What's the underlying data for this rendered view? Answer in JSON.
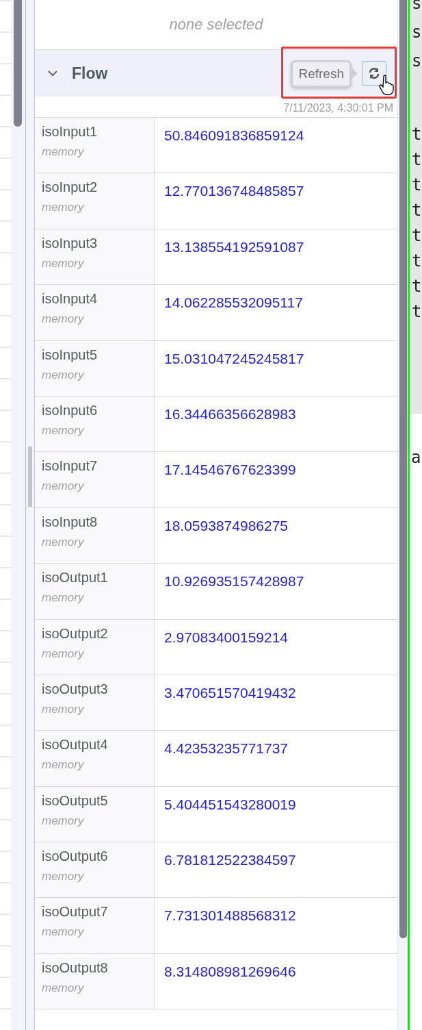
{
  "selection": {
    "text": "none selected"
  },
  "section": {
    "title": "Flow",
    "expanded": true,
    "tooltip": "Refresh",
    "timestamp": "7/11/2023, 4:30:01 PM"
  },
  "rows": [
    {
      "name": "isoInput1",
      "store": "memory",
      "value": "50.846091836859124"
    },
    {
      "name": "isoInput2",
      "store": "memory",
      "value": "12.770136748485857"
    },
    {
      "name": "isoInput3",
      "store": "memory",
      "value": "13.138554192591087"
    },
    {
      "name": "isoInput4",
      "store": "memory",
      "value": "14.062285532095117"
    },
    {
      "name": "isoInput5",
      "store": "memory",
      "value": "15.031047245245817"
    },
    {
      "name": "isoInput6",
      "store": "memory",
      "value": "16.34466356628983"
    },
    {
      "name": "isoInput7",
      "store": "memory",
      "value": "17.14546767623399"
    },
    {
      "name": "isoInput8",
      "store": "memory",
      "value": "18.0593874986275"
    },
    {
      "name": "isoOutput1",
      "store": "memory",
      "value": "10.926935157428987"
    },
    {
      "name": "isoOutput2",
      "store": "memory",
      "value": "2.97083400159214"
    },
    {
      "name": "isoOutput3",
      "store": "memory",
      "value": "3.470651570419432"
    },
    {
      "name": "isoOutput4",
      "store": "memory",
      "value": "4.42353235771737"
    },
    {
      "name": "isoOutput5",
      "store": "memory",
      "value": "5.404451543280019"
    },
    {
      "name": "isoOutput6",
      "store": "memory",
      "value": "6.781812522384597"
    },
    {
      "name": "isoOutput7",
      "store": "memory",
      "value": "7.731301488568312"
    },
    {
      "name": "isoOutput8",
      "store": "memory",
      "value": "8.314808981269646"
    }
  ],
  "code_lines": [
    "s",
    "s",
    "s"
  ],
  "code_lines_mid": [
    "t",
    "t",
    "t",
    "t",
    "t",
    "t",
    "t",
    "t"
  ],
  "code_lines_below": [
    "a"
  ]
}
